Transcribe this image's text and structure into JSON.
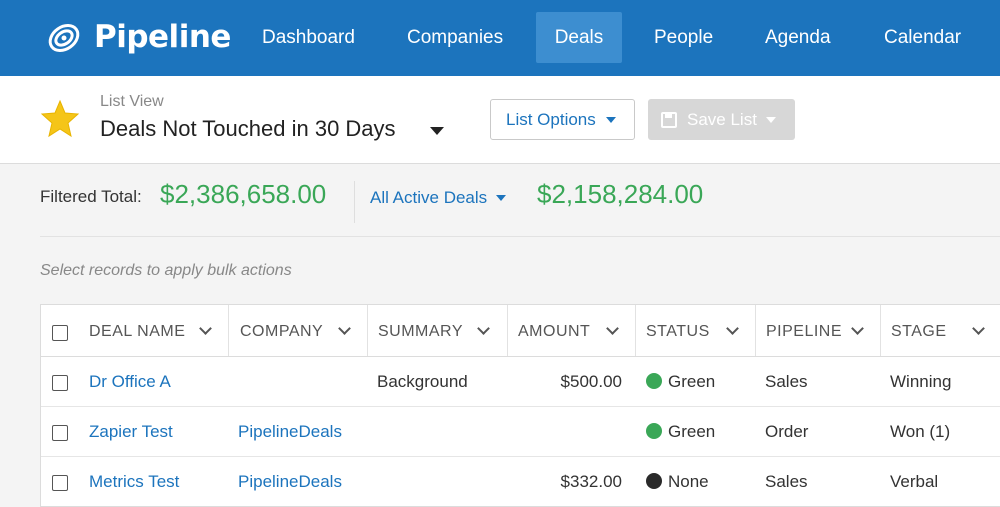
{
  "app": {
    "name": "Pipeline"
  },
  "nav": [
    {
      "label": "Dashboard",
      "active": false
    },
    {
      "label": "Companies",
      "active": false
    },
    {
      "label": "Deals",
      "active": true
    },
    {
      "label": "People",
      "active": false
    },
    {
      "label": "Agenda",
      "active": false
    },
    {
      "label": "Calendar",
      "active": false
    }
  ],
  "list_view": {
    "label": "List View",
    "title": "Deals Not Touched in 30 Days",
    "options_button": "List Options",
    "save_button": "Save List"
  },
  "totals": {
    "filtered_label": "Filtered Total:",
    "filtered_value": "$2,386,658.00",
    "scope_label": "All Active Deals",
    "scope_value": "$2,158,284.00"
  },
  "bulk_hint": "Select records to apply bulk actions",
  "table": {
    "columns": [
      "DEAL NAME",
      "COMPANY",
      "SUMMARY",
      "AMOUNT",
      "STATUS",
      "PIPELINE",
      "STAGE"
    ],
    "rows": [
      {
        "deal": "Dr Office A",
        "company": "",
        "summary": "Background",
        "amount": "$500.00",
        "status": "Green",
        "status_color": "#3aa757",
        "pipeline": "Sales",
        "stage": "Winning"
      },
      {
        "deal": "Zapier Test",
        "company": "PipelineDeals",
        "summary": "",
        "amount": "",
        "status": "Green",
        "status_color": "#3aa757",
        "pipeline": "Order",
        "stage": "Won (1)"
      },
      {
        "deal": "Metrics Test",
        "company": "PipelineDeals",
        "summary": "",
        "amount": "$332.00",
        "status": "None",
        "status_color": "#2a2a2a",
        "pipeline": "Sales",
        "stage": "Verbal"
      }
    ]
  },
  "colors": {
    "brand": "#1c74bd",
    "nav_active": "#3d8ed0",
    "money_green": "#3aa757",
    "star": "#f5c518"
  }
}
